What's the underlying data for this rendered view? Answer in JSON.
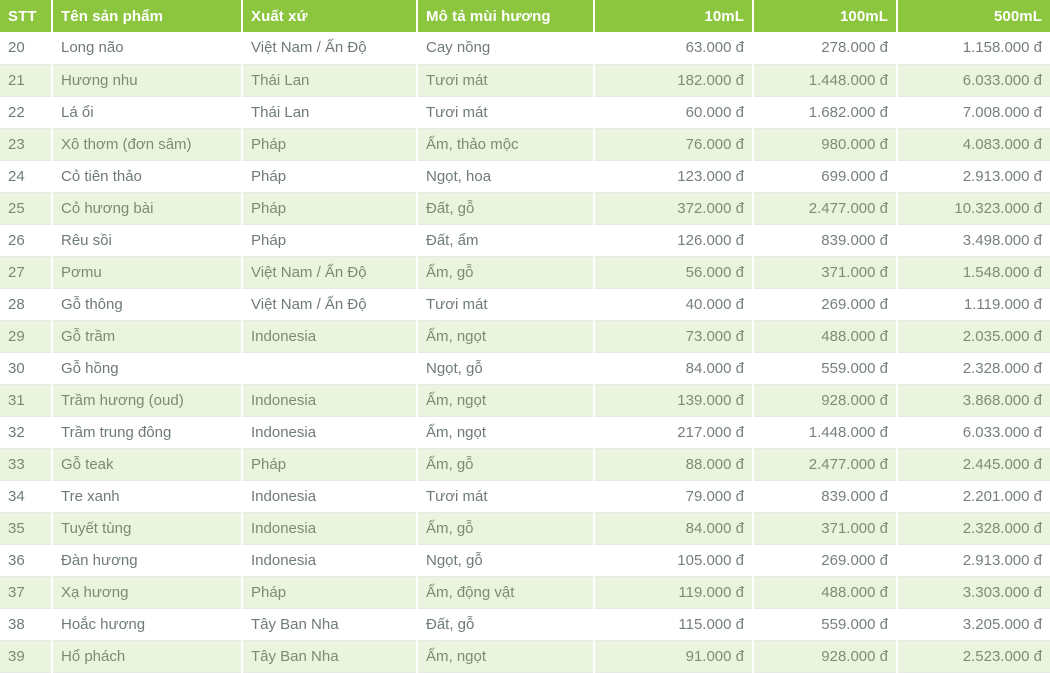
{
  "table": {
    "columns": [
      {
        "key": "stt",
        "label": "STT",
        "align": "left"
      },
      {
        "key": "name",
        "label": "Tên sản phẩm",
        "align": "left"
      },
      {
        "key": "origin",
        "label": "Xuất xứ",
        "align": "left"
      },
      {
        "key": "desc",
        "label": "Mô tả mùi hương",
        "align": "left"
      },
      {
        "key": "p10",
        "label": "10mL",
        "align": "right"
      },
      {
        "key": "p100",
        "label": "100mL",
        "align": "right"
      },
      {
        "key": "p500",
        "label": "500mL",
        "align": "right"
      }
    ],
    "header_background": "#8cc63e",
    "header_text_color": "#ffffff",
    "stripe_color": "#eaf4de",
    "row_color": "#ffffff",
    "currency_symbol": "đ",
    "rows": [
      {
        "stt": "20",
        "name": "Long não",
        "origin": "Việt Nam / Ấn Độ",
        "desc": "Cay nồng",
        "p10": "63.000 đ",
        "p100": "278.000 đ",
        "p500": "1.158.000 đ"
      },
      {
        "stt": "21",
        "name": "Hương nhu",
        "origin": "Thái Lan",
        "desc": "Tươi mát",
        "p10": "182.000 đ",
        "p100": "1.448.000 đ",
        "p500": "6.033.000 đ"
      },
      {
        "stt": "22",
        "name": "Lá ổi",
        "origin": "Thái Lan",
        "desc": "Tươi mát",
        "p10": "60.000 đ",
        "p100": "1.682.000 đ",
        "p500": "7.008.000 đ"
      },
      {
        "stt": "23",
        "name": "Xô thơm (đơn sâm)",
        "origin": "Pháp",
        "desc": "Ấm, thảo mộc",
        "p10": "76.000 đ",
        "p100": "980.000 đ",
        "p500": "4.083.000 đ"
      },
      {
        "stt": "24",
        "name": "Cỏ tiên thảo",
        "origin": "Pháp",
        "desc": "Ngọt, hoa",
        "p10": "123.000 đ",
        "p100": "699.000 đ",
        "p500": "2.913.000 đ"
      },
      {
        "stt": "25",
        "name": "Cỏ hương bài",
        "origin": "Pháp",
        "desc": "Đất, gỗ",
        "p10": "372.000 đ",
        "p100": "2.477.000 đ",
        "p500": "10.323.000 đ"
      },
      {
        "stt": "26",
        "name": "Rêu sồi",
        "origin": "Pháp",
        "desc": "Đất, ẩm",
        "p10": "126.000 đ",
        "p100": "839.000 đ",
        "p500": "3.498.000 đ"
      },
      {
        "stt": "27",
        "name": "Pơmu",
        "origin": "Việt Nam / Ấn Độ",
        "desc": "Ấm, gỗ",
        "p10": "56.000 đ",
        "p100": "371.000 đ",
        "p500": "1.548.000 đ"
      },
      {
        "stt": "28",
        "name": "Gỗ thông",
        "origin": "Việt Nam / Ấn Độ",
        "desc": "Tươi mát",
        "p10": "40.000 đ",
        "p100": "269.000 đ",
        "p500": "1.119.000 đ"
      },
      {
        "stt": "29",
        "name": "Gỗ trầm",
        "origin": "Indonesia",
        "desc": "Ấm, ngọt",
        "p10": "73.000 đ",
        "p100": "488.000 đ",
        "p500": "2.035.000 đ"
      },
      {
        "stt": "30",
        "name": "Gỗ hồng",
        "origin": "",
        "desc": "Ngọt, gỗ",
        "p10": "84.000 đ",
        "p100": "559.000 đ",
        "p500": "2.328.000 đ"
      },
      {
        "stt": "31",
        "name": "Trầm hương (oud)",
        "origin": "Indonesia",
        "desc": "Ấm, ngọt",
        "p10": "139.000 đ",
        "p100": "928.000 đ",
        "p500": "3.868.000 đ"
      },
      {
        "stt": "32",
        "name": "Trầm trung đông",
        "origin": "Indonesia",
        "desc": "Ấm, ngọt",
        "p10": "217.000 đ",
        "p100": "1.448.000 đ",
        "p500": "6.033.000 đ"
      },
      {
        "stt": "33",
        "name": "Gỗ teak",
        "origin": "Pháp",
        "desc": "Ấm, gỗ",
        "p10": "88.000 đ",
        "p100": "2.477.000 đ",
        "p500": "2.445.000 đ"
      },
      {
        "stt": "34",
        "name": "Tre xanh",
        "origin": "Indonesia",
        "desc": "Tươi mát",
        "p10": "79.000 đ",
        "p100": "839.000 đ",
        "p500": "2.201.000 đ"
      },
      {
        "stt": "35",
        "name": "Tuyết tùng",
        "origin": "Indonesia",
        "desc": "Ấm, gỗ",
        "p10": "84.000 đ",
        "p100": "371.000 đ",
        "p500": "2.328.000 đ"
      },
      {
        "stt": "36",
        "name": "Đàn hương",
        "origin": "Indonesia",
        "desc": "Ngọt, gỗ",
        "p10": "105.000 đ",
        "p100": "269.000 đ",
        "p500": "2.913.000 đ"
      },
      {
        "stt": "37",
        "name": "Xạ hương",
        "origin": "Pháp",
        "desc": "Ấm, động vật",
        "p10": "119.000 đ",
        "p100": "488.000 đ",
        "p500": "3.303.000 đ"
      },
      {
        "stt": "38",
        "name": "Hoắc hương",
        "origin": "Tây Ban Nha",
        "desc": "Đất, gỗ",
        "p10": "115.000 đ",
        "p100": "559.000 đ",
        "p500": "3.205.000 đ"
      },
      {
        "stt": "39",
        "name": "Hổ phách",
        "origin": "Tây Ban Nha",
        "desc": "Ấm, ngọt",
        "p10": "91.000 đ",
        "p100": "928.000 đ",
        "p500": "2.523.000 đ"
      }
    ]
  }
}
